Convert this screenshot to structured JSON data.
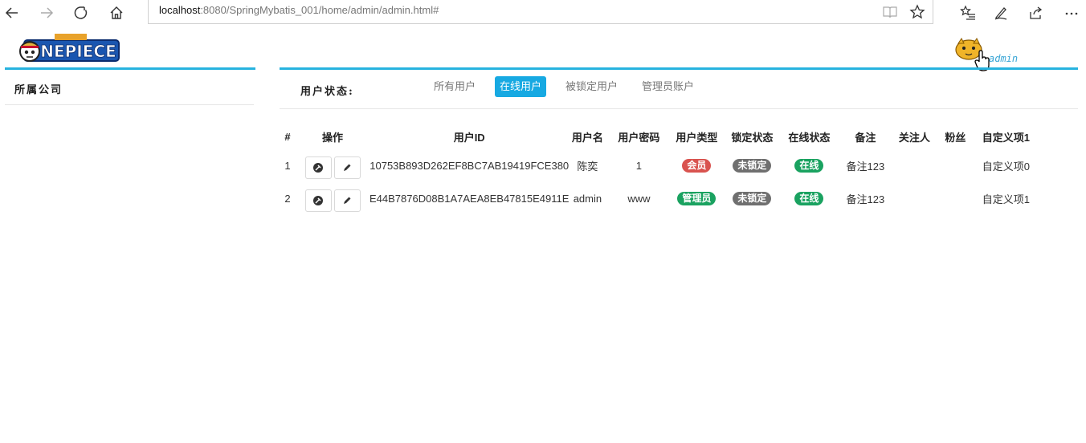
{
  "browser": {
    "url_host": "localhost",
    "url_rest": ":8080/SpringMybatis_001/home/admin/admin.html#"
  },
  "logo": {
    "alt": "ONE PIECE"
  },
  "user": {
    "name": "admin"
  },
  "sidebar": {
    "title": "所属公司"
  },
  "filter": {
    "label": "用户状态:",
    "tabs": [
      {
        "label": "所有用户",
        "active": false
      },
      {
        "label": "在线用户",
        "active": true
      },
      {
        "label": "被锁定用户",
        "active": false
      },
      {
        "label": "管理员账户",
        "active": false
      }
    ]
  },
  "table": {
    "headers": [
      "#",
      "操作",
      "用户ID",
      "用户名",
      "用户密码",
      "用户类型",
      "锁定状态",
      "在线状态",
      "备注",
      "关注人",
      "粉丝",
      "自定义项1"
    ],
    "rows": [
      {
        "index": "1",
        "user_id": "10753B893D262EF8BC7AB19419FCE380",
        "username": "陈奕",
        "password": "1",
        "type": "会员",
        "lock": "未锁定",
        "online": "在线",
        "remark": "备注123",
        "follow": "",
        "fans": "",
        "custom1": "自定义项0"
      },
      {
        "index": "2",
        "user_id": "E44B7876D08B1A7AEA8EB47815E4911E",
        "username": "admin",
        "password": "www",
        "type": "管理员",
        "lock": "未锁定",
        "online": "在线",
        "remark": "备注123",
        "follow": "",
        "fans": "",
        "custom1": "自定义项1"
      }
    ]
  },
  "colors": {
    "accent": "#27b3df",
    "tab_active": "#17a9e2",
    "badge_member": "#d9534f",
    "badge_admin": "#1aa260",
    "badge_unlocked": "#6f6f6f",
    "badge_online": "#1aa260"
  },
  "icons": {
    "back": "arrow-left-icon",
    "forward": "arrow-right-icon",
    "refresh": "refresh-icon",
    "home": "home-icon",
    "reading": "book-icon",
    "favorite": "star-icon",
    "favorites_list": "favorites-list-icon",
    "pen": "pen-icon",
    "share": "share-icon",
    "more": "more-icon",
    "view": "gavel-icon",
    "edit": "pencil-icon"
  }
}
